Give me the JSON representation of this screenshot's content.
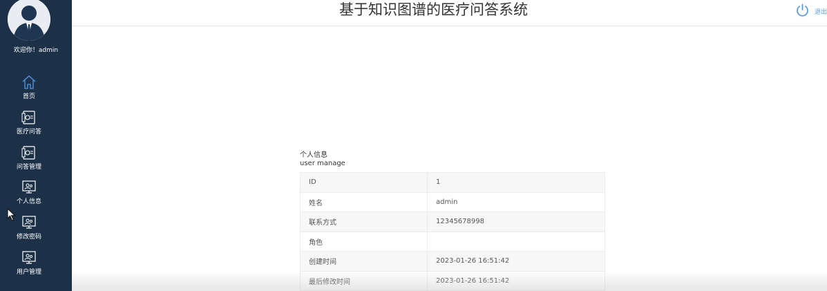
{
  "app": {
    "title": "基于知识图谱的医疗问答系统"
  },
  "header": {
    "logout_label": "退出"
  },
  "sidebar": {
    "welcome": "欢迎你！admin",
    "items": [
      {
        "label": "首页",
        "icon": "home-icon"
      },
      {
        "label": "医疗问答",
        "icon": "document-icon"
      },
      {
        "label": "问答管理",
        "icon": "document-icon"
      },
      {
        "label": "个人信息",
        "icon": "user-monitor-icon"
      },
      {
        "label": "修改密码",
        "icon": "user-monitor-icon"
      },
      {
        "label": "用户管理",
        "icon": "user-monitor-icon"
      }
    ]
  },
  "profile": {
    "title": "个人信息",
    "subtitle": "user manage",
    "rows": [
      {
        "key": "ID",
        "value": "1"
      },
      {
        "key": "姓名",
        "value": "admin"
      },
      {
        "key": "联系方式",
        "value": "12345678998"
      },
      {
        "key": "角色",
        "value": ""
      },
      {
        "key": "创建时间",
        "value": "2023-01-26 16:51:42"
      },
      {
        "key": "最后修改时间",
        "value": "2023-01-26 16:51:42"
      }
    ]
  },
  "colors": {
    "sidebar_bg": "#1c3148",
    "accent": "#5a9bd5"
  }
}
